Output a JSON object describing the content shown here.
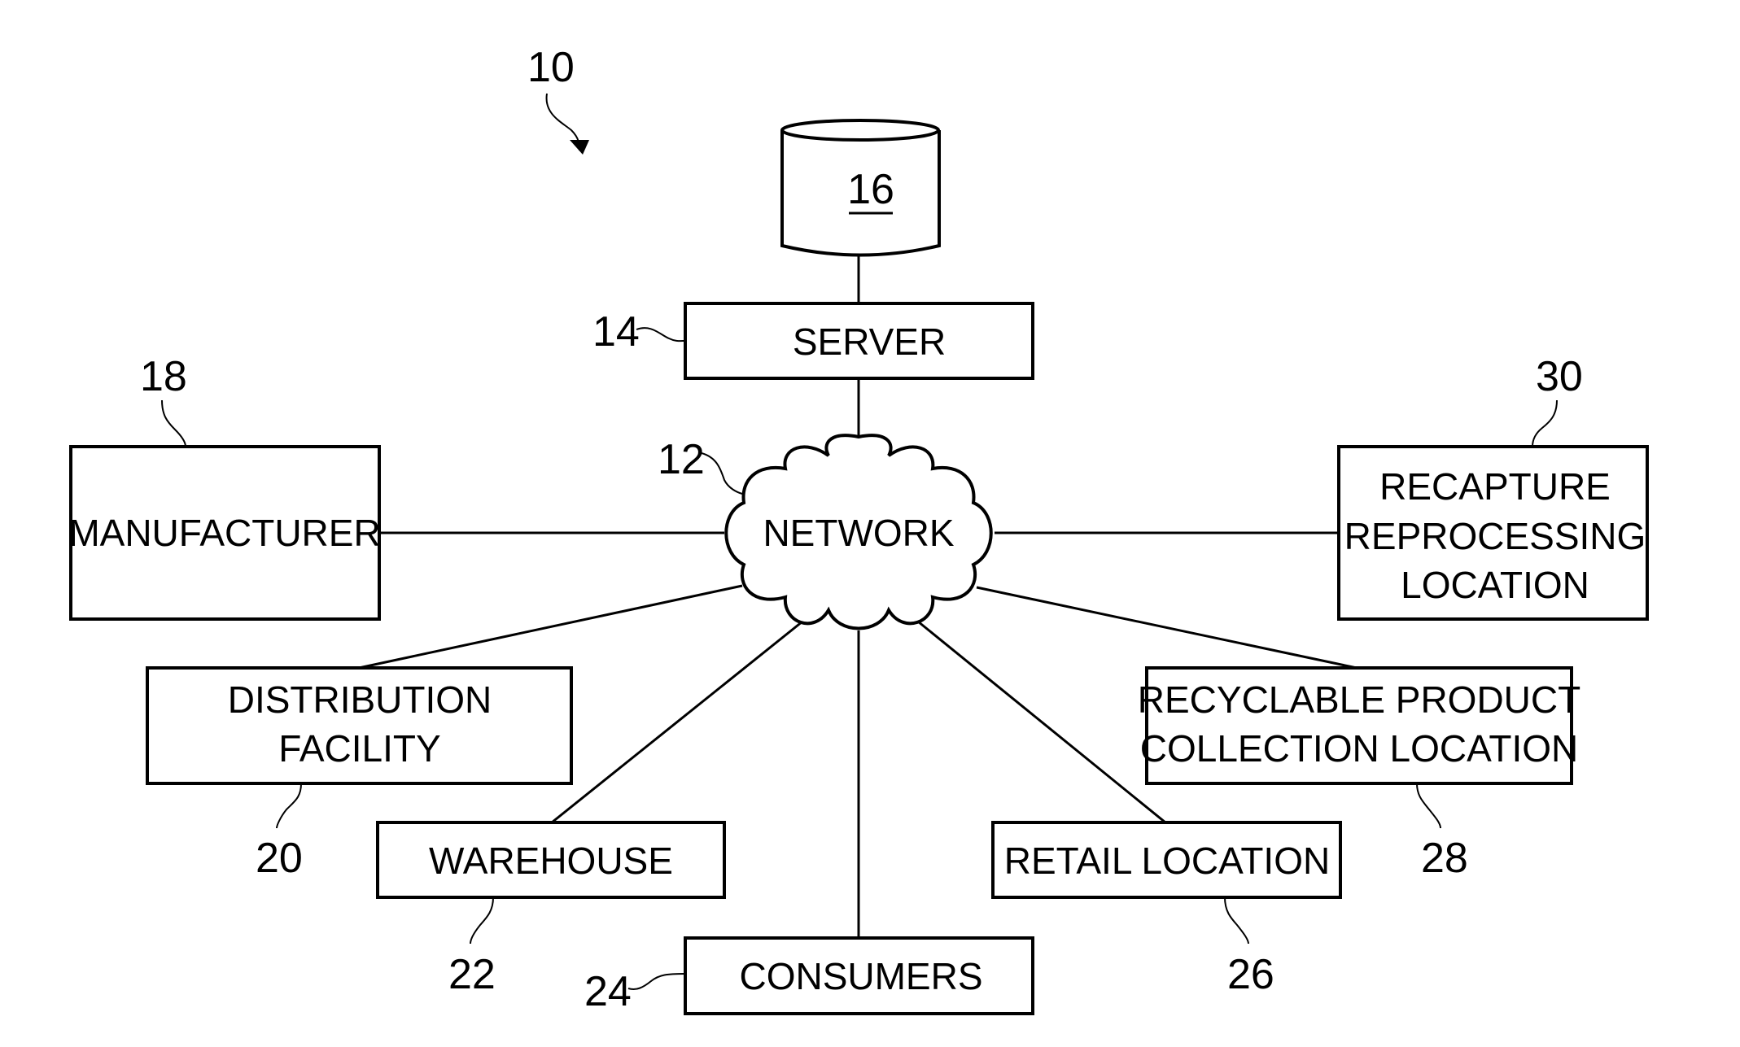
{
  "figure": {
    "reference": "10",
    "database": {
      "ref": "16"
    },
    "server": {
      "ref": "14",
      "label": "SERVER"
    },
    "network": {
      "ref": "12",
      "label": "NETWORK"
    },
    "manufacturer": {
      "ref": "18",
      "label": "MANUFACTURER"
    },
    "recapture": {
      "ref": "30",
      "lines": [
        "RECAPTURE",
        "REPROCESSING",
        "LOCATION"
      ]
    },
    "distribution": {
      "ref": "20",
      "lines": [
        "DISTRIBUTION",
        "FACILITY"
      ]
    },
    "recyclable": {
      "ref": "28",
      "lines": [
        "RECYCLABLE PRODUCT",
        "COLLECTION LOCATION"
      ]
    },
    "warehouse": {
      "ref": "22",
      "label": "WAREHOUSE"
    },
    "retail": {
      "ref": "26",
      "label": "RETAIL LOCATION"
    },
    "consumers": {
      "ref": "24",
      "label": "CONSUMERS"
    }
  }
}
